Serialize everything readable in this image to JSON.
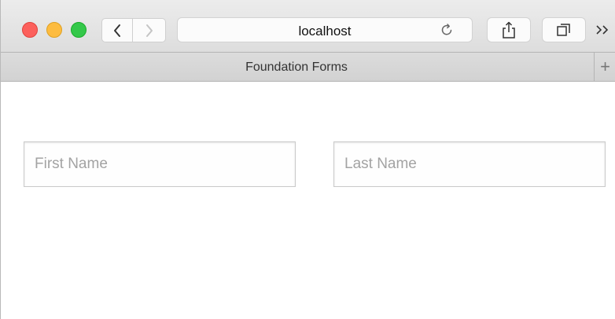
{
  "window": {
    "controls": [
      "close",
      "minimize",
      "maximize"
    ],
    "colors": {
      "close": "#fc605c",
      "minimize": "#fdbc40",
      "maximize": "#34c84a"
    }
  },
  "toolbar": {
    "back_icon": "chevron-left-icon",
    "forward_icon": "chevron-right-icon",
    "address": "localhost",
    "reload_icon": "reload-icon",
    "share_icon": "share-icon",
    "tabs_icon": "tab-overview-icon",
    "overflow_label": ">>"
  },
  "tabbar": {
    "title": "Foundation Forms",
    "new_tab_label": "+"
  },
  "form": {
    "first_name": {
      "value": "",
      "placeholder": "First Name"
    },
    "last_name": {
      "value": "",
      "placeholder": "Last Name"
    }
  }
}
